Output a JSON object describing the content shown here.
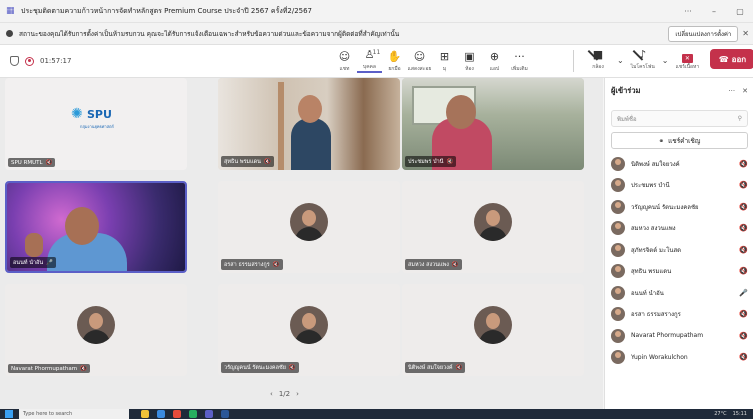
{
  "window": {
    "title": "ประชุมติดตามความก้าวหน้าการจัดทำหลักสูตร Premium Course ประจำปี 2567 ครั้งที่2/2567",
    "controls": [
      "···",
      "–",
      "▢"
    ]
  },
  "banner": {
    "message": "สถานะของคุณได้รับการตั้งค่าเป็นห้ามรบกวน คุณจะได้รับการแจ้งเตือนเฉพาะสำหรับข้อความด่วนและข้อความจากผู้ติดต่อที่สำคัญเท่านั้น",
    "action_label": "เปลี่ยนแปลงการตั้งค่า",
    "close": "✕"
  },
  "toolbar": {
    "elapsed": "01:57:17",
    "buttons": [
      {
        "label": "แชท",
        "icon": "chat-icon",
        "glyph": "☺"
      },
      {
        "label": "บุคคล",
        "icon": "people-icon",
        "glyph": "♙",
        "count": "11"
      },
      {
        "label": "ยกมือ",
        "icon": "raise-hand-icon",
        "glyph": "✋"
      },
      {
        "label": "แสดงสะอย",
        "icon": "react-icon",
        "glyph": "☺"
      },
      {
        "label": "มุ",
        "icon": "view-icon",
        "glyph": "⊞"
      },
      {
        "label": "ห้อง",
        "icon": "rooms-icon",
        "glyph": "▣"
      },
      {
        "label": "แอป",
        "icon": "apps-icon",
        "glyph": "⊕"
      },
      {
        "label": "เพิ่มเติม",
        "icon": "more-icon",
        "glyph": "···"
      }
    ],
    "right": [
      {
        "label": "กล้อง",
        "icon": "camera-off-icon",
        "glyph": "▶"
      },
      {
        "label": "ไมโครโฟน",
        "icon": "mic-off-icon",
        "glyph": "🎤"
      },
      {
        "label": "แชร์เนื้อหา",
        "icon": "share-icon",
        "glyph": "↑"
      }
    ],
    "leave_label": "ออก"
  },
  "tiles": [
    {
      "name": "SPU RMUTL"
    },
    {
      "name": "สุทธิน พรมแดน"
    },
    {
      "name": "ประชมพร บำนี"
    },
    {
      "name": "อนนท์ นำอัน"
    },
    {
      "name": "อรสา ธรรมสรางกูร"
    },
    {
      "name": "สมหวง สงวนแพง"
    },
    {
      "name": "Navarat Phormupatham"
    },
    {
      "name": "วรัญญูคนน์ รัตนะมงคลชัย"
    },
    {
      "name": "นิติพงษ์ สมใจยวงค์"
    }
  ],
  "spu_logo": {
    "text": "SPU",
    "sub": "กลุ่มงานยุทธศาสตร์"
  },
  "pager": {
    "prev": "‹",
    "label": "1/2",
    "next": "›"
  },
  "panel": {
    "title": "ผู้เข้าร่วม",
    "more": "···",
    "close": "✕",
    "search_placeholder": "พิมพ์ชื่อ",
    "invite_label": "แชร์คำเชิญ",
    "participants": [
      {
        "name": "นิติพงษ์ สมใจยวงค์",
        "mic": "🔇"
      },
      {
        "name": "ประชมพร บำนี",
        "mic": "🔇"
      },
      {
        "name": "วรัญญูคนน์ รัตนะมงคลชัย",
        "mic": "🔇"
      },
      {
        "name": "สมหวง สงวนแพง",
        "mic": "🔇"
      },
      {
        "name": "สุภัทรจิตต์ มะโนสด",
        "mic": "🔇"
      },
      {
        "name": "สุทธิน พรมแดน",
        "mic": "🔇"
      },
      {
        "name": "อนนท์ นำอัน",
        "mic": "🎤"
      },
      {
        "name": "อรสา ธรรมสรางกูร",
        "mic": "🔇"
      },
      {
        "name": "Navarat Phormupatham",
        "mic": "🔇"
      },
      {
        "name": "Yupin Worakulchon",
        "mic": "🔇"
      }
    ]
  },
  "taskbar": {
    "search_placeholder": "Type here to search",
    "temp": "27°C",
    "time": "15:11"
  }
}
